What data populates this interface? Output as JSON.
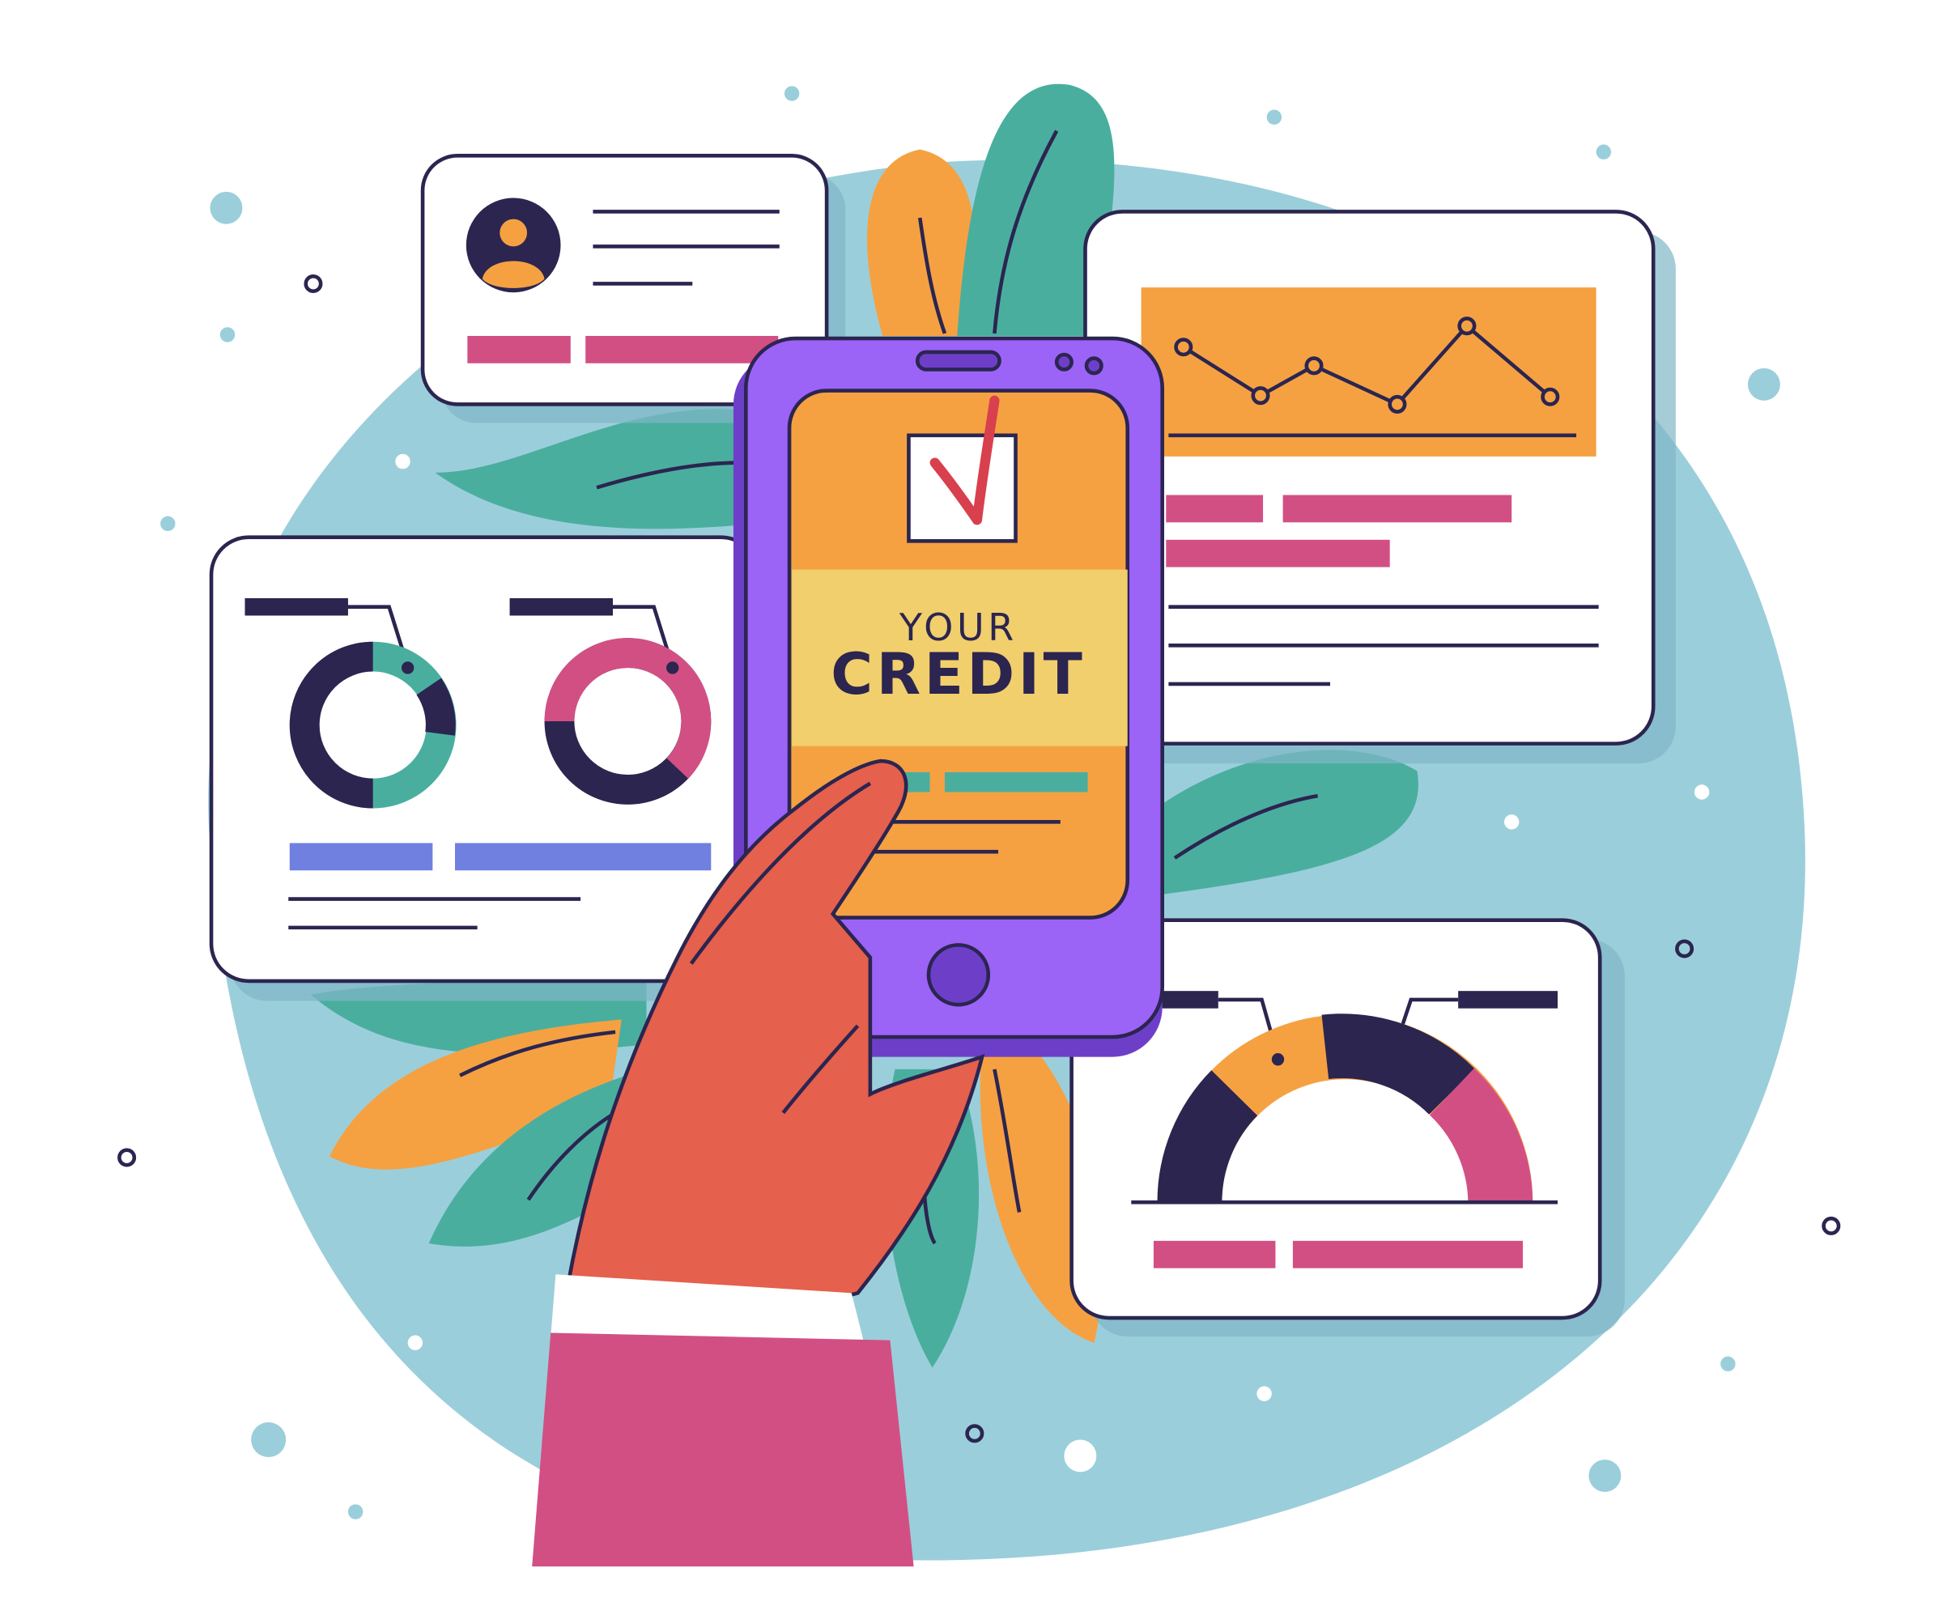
{
  "phone": {
    "caption_small": "YOUR",
    "caption_large": "CREDIT"
  },
  "colors": {
    "background_blob": "#9bcedb",
    "leaf_green": "#4aae9f",
    "leaf_orange": "#f5a142",
    "phone_body": "#9c63f7",
    "phone_screen": "#f5a142",
    "phone_banner": "#f1cf6c",
    "card_fill": "#ffffff",
    "outline": "#2b2550",
    "accent_pink": "#d24f84",
    "accent_blue": "#6f80e0",
    "hand": "#e5604d",
    "sleeve": "#d24f84",
    "check_mark": "#d8404e"
  },
  "icons": [
    "checkbox-icon",
    "avatar-icon",
    "line-chart-icon",
    "donut-chart-icon",
    "gauge-chart-icon"
  ]
}
